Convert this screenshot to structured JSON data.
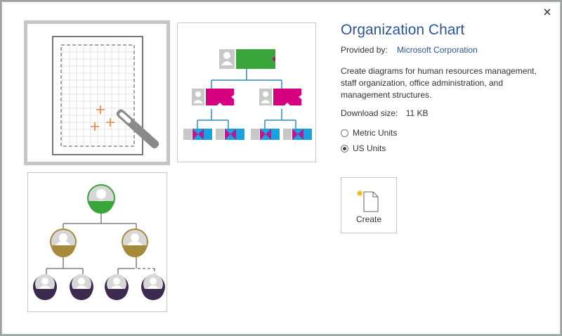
{
  "dialog": {
    "close_icon": "close-icon",
    "template": {
      "title": "Organization Chart",
      "provided_by_label": "Provided by:",
      "provider": "Microsoft Corporation",
      "description": "Create diagrams for human resources management, staff organization, office administration, and management structures.",
      "download_size_label": "Download size:",
      "download_size": "11 KB",
      "units": [
        {
          "label": "Metric Units",
          "selected": false
        },
        {
          "label": "US Units",
          "selected": true
        }
      ],
      "create_label": "Create"
    },
    "thumbnails": [
      {
        "name": "blank-drawing",
        "selected": true
      },
      {
        "name": "org-chart-boxes",
        "selected": false
      },
      {
        "name": "org-chart-circles",
        "selected": false
      }
    ]
  },
  "colors": {
    "title": "#2b579a",
    "green": "#3aa53a",
    "magenta": "#d5007f",
    "blue": "#1ba1e2",
    "gold": "#a78a3a",
    "purple": "#3d2a4f",
    "connector": "#2e8bc0"
  }
}
